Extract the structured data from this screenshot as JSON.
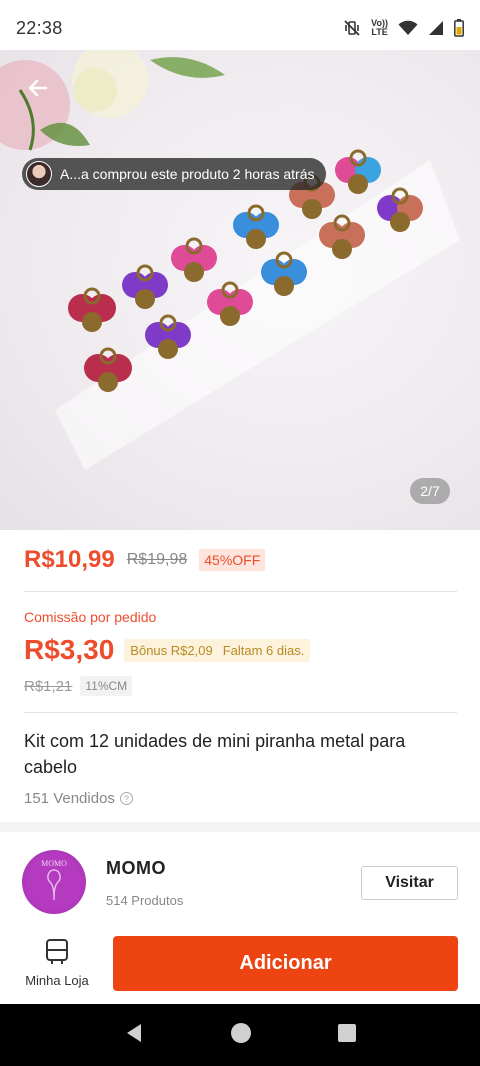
{
  "status_bar": {
    "time": "22:38",
    "network_label_top": "Vo))",
    "network_label_bottom": "LTE"
  },
  "product": {
    "buyer_notice": "A...a comprou este produto 2 horas atrás",
    "image_counter": "2/7",
    "price": "R$10,99",
    "original_price": "R$19,98",
    "discount": "45%OFF",
    "commission_label": "Comissão por pedido",
    "commission_value": "R$3,30",
    "bonus_text": "Bônus R$2,09",
    "bonus_remaining": "Faltam 6 dias.",
    "old_commission": "R$1,21",
    "commission_rate": "11%CM",
    "title": "Kit com 12 unidades de mini piranha metal para cabelo",
    "sold": "151 Vendidos"
  },
  "shop": {
    "name": "MOMO",
    "product_count": "514 Produtos",
    "visit_label": "Visitar",
    "avatar_text": "MOMO"
  },
  "bottom_bar": {
    "my_store_label": "Minha Loja",
    "add_label": "Adicionar"
  },
  "colors": {
    "accent": "#ee4d2d",
    "add_button": "#ee4412",
    "bonus_text": "#b88a26"
  },
  "icons": [
    "muted-vibrate-icon",
    "volte-icon",
    "wifi-icon",
    "signal-icon",
    "battery-icon",
    "back-arrow-icon",
    "info-icon",
    "store-icon",
    "nav-back-icon",
    "nav-home-icon",
    "nav-recents-icon"
  ]
}
